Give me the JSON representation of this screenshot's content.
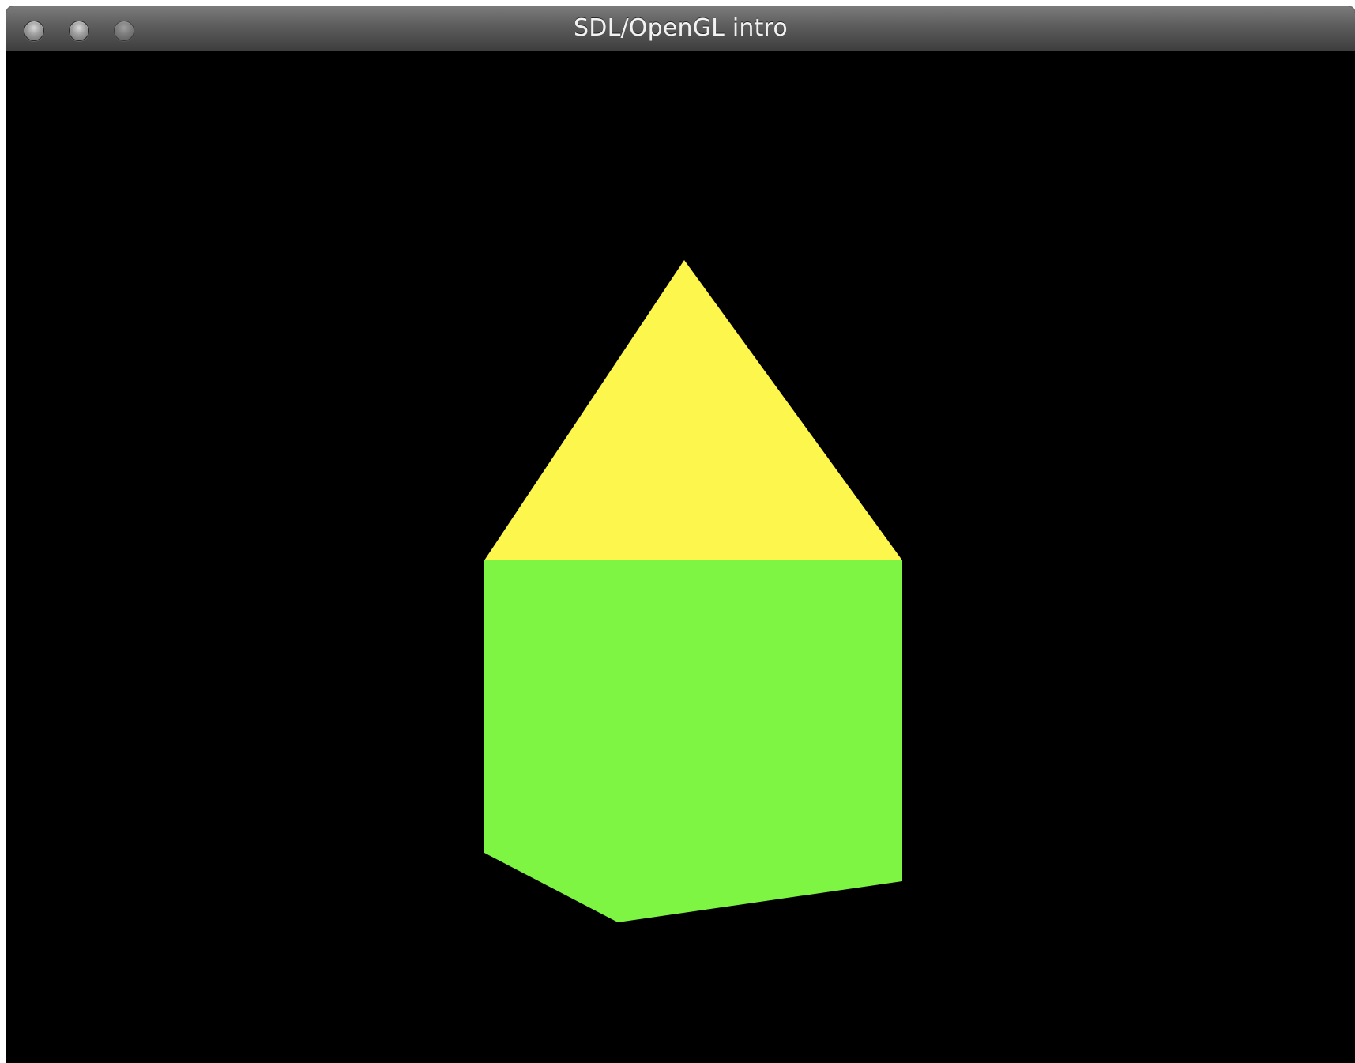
{
  "window": {
    "title": "SDL/OpenGL intro",
    "buttons": [
      "close",
      "minimize",
      "zoom"
    ]
  },
  "scene": {
    "background_color": "#000000",
    "shapes": [
      {
        "name": "roof-triangle",
        "color": "#fdf64d"
      },
      {
        "name": "wall-prism",
        "color": "#7ef542"
      }
    ]
  }
}
